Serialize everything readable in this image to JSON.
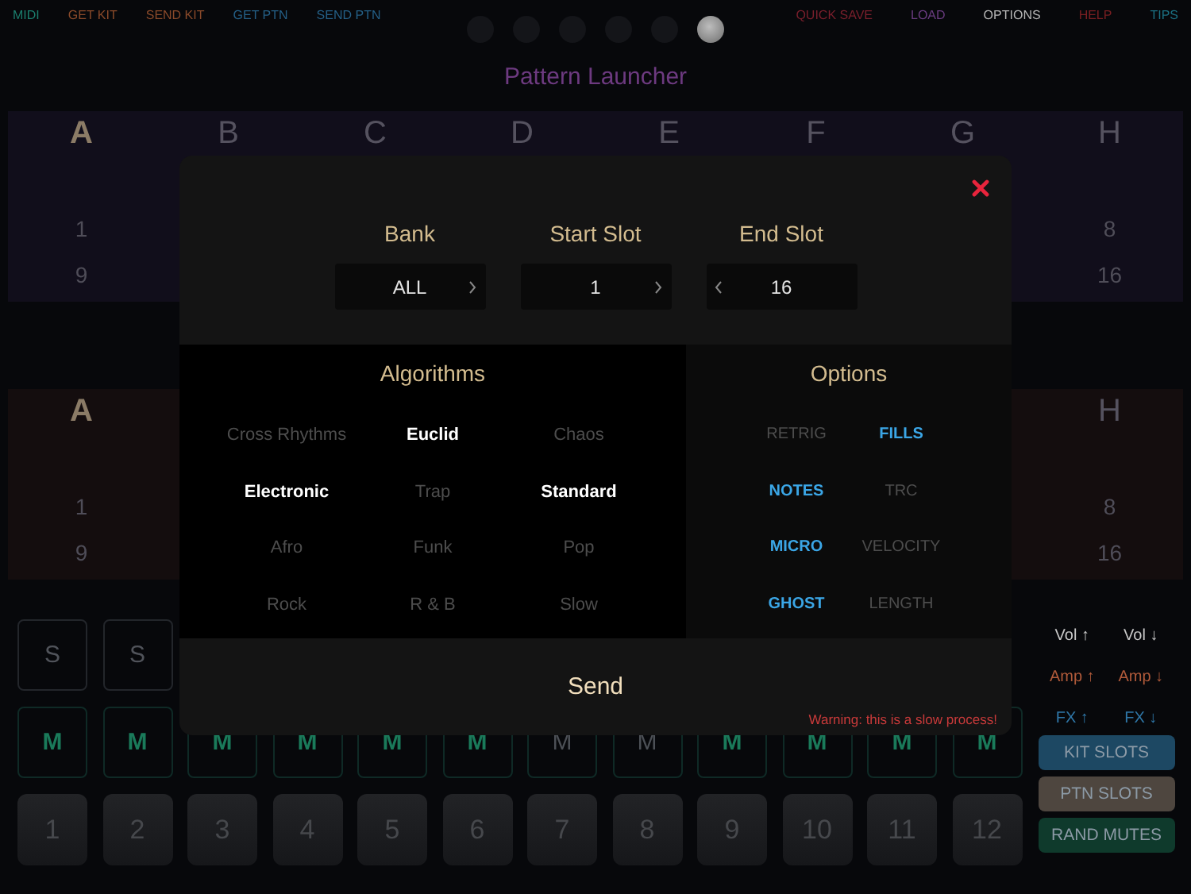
{
  "nav_left": [
    {
      "label": "MIDI",
      "color": "#1b7f6e"
    },
    {
      "label": "GET KIT",
      "color": "#8a4a2a"
    },
    {
      "label": "SEND KIT",
      "color": "#8a4a2a"
    },
    {
      "label": "GET PTN",
      "color": "#245f86"
    },
    {
      "label": "SEND PTN",
      "color": "#245f86"
    }
  ],
  "page_dots": [
    {
      "selected": false
    },
    {
      "selected": false
    },
    {
      "selected": false
    },
    {
      "selected": false
    },
    {
      "selected": false
    },
    {
      "selected": true
    }
  ],
  "nav_right": [
    {
      "label": "QUICK SAVE",
      "color": "#7a1f2c"
    },
    {
      "label": "LOAD",
      "color": "#6a3c80"
    },
    {
      "label": "OPTIONS",
      "color": "#b5b5b5"
    },
    {
      "label": "HELP",
      "color": "#7a1f22"
    },
    {
      "label": "TIPS",
      "color": "#1b7082"
    }
  ],
  "title": "Pattern Launcher",
  "banks": [
    {
      "color": "#110e1b",
      "letters": [
        {
          "label": "A",
          "selected": true
        },
        {
          "label": "B",
          "selected": false
        },
        {
          "label": "C",
          "selected": false
        },
        {
          "label": "D",
          "selected": false
        },
        {
          "label": "E",
          "selected": false
        },
        {
          "label": "F",
          "selected": false
        },
        {
          "label": "G",
          "selected": false
        },
        {
          "label": "H",
          "selected": false
        }
      ],
      "rows": [
        [
          "1",
          "8"
        ],
        [
          "9",
          "16"
        ]
      ]
    },
    {
      "color": "#140d0e",
      "letters": [
        {
          "label": "A",
          "selected": true
        },
        {
          "label": "H",
          "selected": false
        }
      ],
      "rows": [
        [
          "1",
          "8"
        ],
        [
          "9",
          "16"
        ]
      ]
    }
  ],
  "solo_buttons": [
    "S",
    "S"
  ],
  "mute_buttons": [
    {
      "label": "M",
      "on": true
    },
    {
      "label": "M",
      "on": true
    },
    {
      "label": "M",
      "on": true
    },
    {
      "label": "M",
      "on": true
    },
    {
      "label": "M",
      "on": true
    },
    {
      "label": "M",
      "on": true
    },
    {
      "label": "M",
      "on": false
    },
    {
      "label": "M",
      "on": false
    },
    {
      "label": "M",
      "on": true
    },
    {
      "label": "M",
      "on": true
    },
    {
      "label": "M",
      "on": true
    },
    {
      "label": "M",
      "on": true
    }
  ],
  "pads": [
    "1",
    "2",
    "3",
    "4",
    "5",
    "6",
    "7",
    "8",
    "9",
    "10",
    "11",
    "12"
  ],
  "side_controls": [
    {
      "label": "Vol ↑",
      "color": "#c8c8c8"
    },
    {
      "label": "Vol ↓",
      "color": "#c8c8c8"
    },
    {
      "label": "Amp ↑",
      "color": "#b05a3a"
    },
    {
      "label": "Amp ↓",
      "color": "#b05a3a"
    },
    {
      "label": "FX ↑",
      "color": "#2f77a8"
    },
    {
      "label": "FX ↓",
      "color": "#2f77a8"
    }
  ],
  "slot_buttons": [
    {
      "label": "KIT SLOTS",
      "color": "#1d4863"
    },
    {
      "label": "PTN SLOTS",
      "color": "#4e463f"
    },
    {
      "label": "RAND MUTES",
      "color": "#0f3a2c"
    }
  ],
  "dialog": {
    "selectors": [
      {
        "label": "Bank",
        "value": "ALL",
        "prev": false,
        "next": true
      },
      {
        "label": "Start Slot",
        "value": "1",
        "prev": false,
        "next": true
      },
      {
        "label": "End Slot",
        "value": "16",
        "prev": true,
        "next": false
      }
    ],
    "algorithms": {
      "title": "Algorithms",
      "items": [
        {
          "label": "Cross Rhythms",
          "selected": false
        },
        {
          "label": "Euclid",
          "selected": true
        },
        {
          "label": "Chaos",
          "selected": false
        },
        {
          "label": "Electronic",
          "selected": true
        },
        {
          "label": "Trap",
          "selected": false
        },
        {
          "label": "Standard",
          "selected": true
        },
        {
          "label": "Afro",
          "selected": false
        },
        {
          "label": "Funk",
          "selected": false
        },
        {
          "label": "Pop",
          "selected": false
        },
        {
          "label": "Rock",
          "selected": false
        },
        {
          "label": "R & B",
          "selected": false
        },
        {
          "label": "Slow",
          "selected": false
        }
      ]
    },
    "options": {
      "title": "Options",
      "items": [
        {
          "label": "RETRIG",
          "on": false
        },
        {
          "label": "FILLS",
          "on": true
        },
        {
          "label": "NOTES",
          "on": true
        },
        {
          "label": "TRC",
          "on": false
        },
        {
          "label": "MICRO",
          "on": true
        },
        {
          "label": "VELOCITY",
          "on": false
        },
        {
          "label": "GHOST",
          "on": true
        },
        {
          "label": "LENGTH",
          "on": false
        }
      ]
    },
    "send_label": "Send",
    "warning": "Warning: this is a slow process!"
  }
}
